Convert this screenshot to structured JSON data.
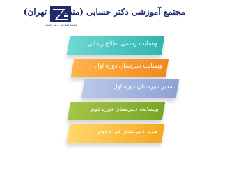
{
  "header": {
    "org_title": "مجتمع آموزشی دکتر حسابی (منطقه ۵ تهران)",
    "logo_caption": "مجتمع آموزشی دکتر حسابی"
  },
  "menu": [
    {
      "label": "وبسایت رسمی اطلاع رسانی",
      "color": "#2fb6b0"
    },
    {
      "label": "وبسایت دبیرستان دوره اول",
      "color": "#f08a1e"
    },
    {
      "label": "مدیر دبیرستان دوره اول",
      "color": "#8ea3d6"
    },
    {
      "label": "وبسایت دبیرستان دوره دوم",
      "color": "#79a626"
    },
    {
      "label": "مدیر دبیرستان دوره دوم",
      "color": "#f4a81f"
    }
  ]
}
